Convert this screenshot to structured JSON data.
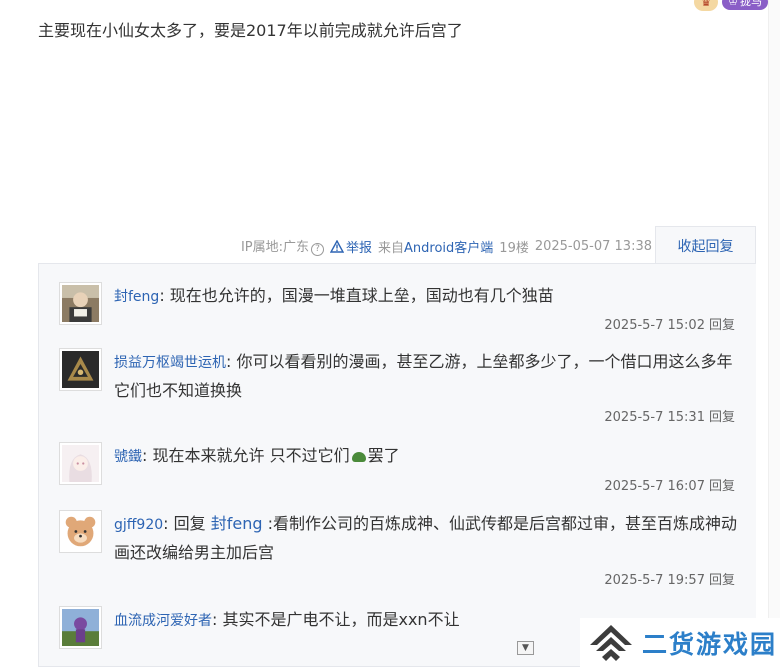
{
  "post": {
    "body": "主要现在小仙女太多了，要是2017年以前完成就允许后宫了",
    "badge_label": "拢马"
  },
  "meta": {
    "ip_location": "IP属地:广东",
    "report_label": "举报",
    "source_prefix": "来自",
    "source_link": "Android客户端",
    "floor": "19楼",
    "timestamp": "2025-05-07 13:38",
    "collapse_label": "收起回复"
  },
  "replies": [
    {
      "user": "封feng",
      "content": "现在也允许的，国漫一堆直球上垒，国动也有几个独苗",
      "time": "2025-5-7 15:02",
      "reply_label": "回复",
      "avatar": "portrait-avatar"
    },
    {
      "user": "损益万枢竭世运机",
      "content": "你可以看看别的漫画，甚至乙游，上垒都多少了，一个借口用这么多年它们也不知道换换",
      "time": "2025-5-7 15:31",
      "reply_label": "回复",
      "avatar": "emblem-avatar"
    },
    {
      "user": "號鐵",
      "content_before": "现在本来就允许 只不过它们",
      "content_after": "罢了",
      "time": "2025-5-7 16:07",
      "reply_label": "回复",
      "avatar": "anime-avatar"
    },
    {
      "user": "gjff920",
      "reply_word": "回复",
      "mention": "封feng",
      "content": ":看制作公司的百炼成神、仙武传都是后宫都过审，甚至百炼成神动画还改编给男主加后宫",
      "time": "2025-5-7 19:57",
      "reply_label": "回复",
      "avatar": "bear-avatar"
    },
    {
      "user": "血流成河爱好者",
      "content": "其实不是广电不让，而是xxn不让",
      "avatar": "landscape-avatar"
    }
  ],
  "watermark": {
    "text": "二货游戏园"
  },
  "colors": {
    "link": "#2d64b3",
    "panel_bg": "#f7f8fa",
    "watermark": "#2c7fc9"
  }
}
